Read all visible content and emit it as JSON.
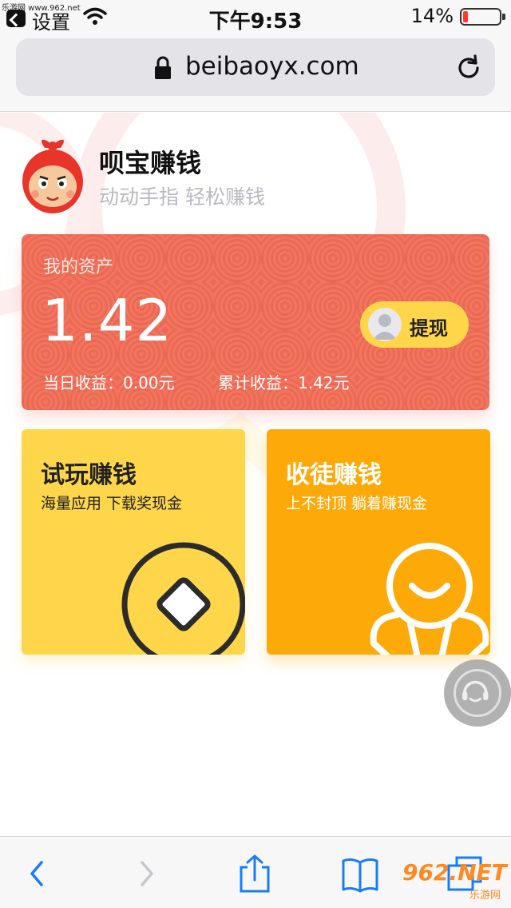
{
  "status_bar": {
    "watermark": "乐游网 www.962.net",
    "back_app_label": "设置",
    "time": "下午9:53",
    "battery_percent": "14%",
    "battery_level": 0.14,
    "battery_color": "#ff3b30"
  },
  "browser": {
    "url": "beibaoyx.com",
    "icons": [
      "lock-icon",
      "reload-icon"
    ]
  },
  "app_header": {
    "title": "呗宝赚钱",
    "slogan": "动动手指 轻松赚钱"
  },
  "asset_card": {
    "label": "我的资产",
    "amount": "1.42",
    "withdraw_label": "提现",
    "today_earnings": "当日收益：0.00元",
    "total_earnings": "累计收益：1.42元",
    "color": "#f26c56"
  },
  "feature_cards": [
    {
      "title": "试玩赚钱",
      "subtitle": "海量应用 下载奖现金",
      "icon": "coin-icon",
      "color": "#ffd64a"
    },
    {
      "title": "收徒赚钱",
      "subtitle": "上不封顶 躺着赚现金",
      "icon": "person-icon",
      "color": "#fdaa09"
    }
  ],
  "support": {
    "icon": "customer-service-icon"
  },
  "toolbar": {
    "icons": [
      "back-icon",
      "forward-icon",
      "share-icon",
      "bookmarks-icon",
      "tabs-icon"
    ],
    "watermark": "962.NET",
    "watermark_sub": "乐游网"
  }
}
